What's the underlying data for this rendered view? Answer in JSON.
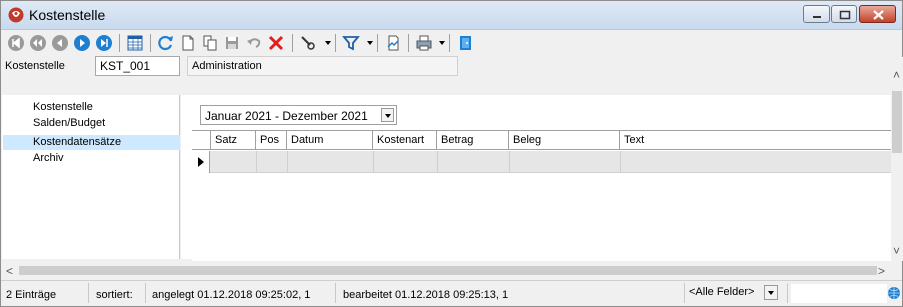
{
  "window": {
    "title": "Kostenstelle"
  },
  "header": {
    "kst_label": "Kostenstelle",
    "kst_value": "KST_001",
    "description": "Administration"
  },
  "nav": {
    "items": [
      {
        "label": "Kostenstelle",
        "selected": false
      },
      {
        "label": "Salden/Budget",
        "selected": false
      },
      {
        "label": "Kostendatensätze",
        "selected": true
      },
      {
        "label": "Archiv",
        "selected": false
      }
    ]
  },
  "content": {
    "period": "Januar 2021 - Dezember 2021",
    "columns": [
      "Satz",
      "Pos",
      "Datum",
      "Kostenart",
      "Betrag",
      "Beleg",
      "Text"
    ]
  },
  "status": {
    "count": "2 Einträge",
    "sorted": "sortiert:",
    "created": "angelegt 01.12.2018 09:25:02,  1",
    "edited": "bearbeitet 01.12.2018 09:25:13,  1",
    "filter": "<Alle Felder>"
  },
  "colors": {
    "selection": "#cde8ff",
    "close_button": "#c2432a",
    "titlebar": "#c9daee"
  },
  "icons": [
    "first-record-icon",
    "previous-page-icon",
    "previous-record-icon",
    "next-record-icon",
    "last-record-icon",
    "table-view-icon",
    "refresh-icon",
    "new-icon",
    "copy-icon",
    "save-icon",
    "undo-icon",
    "delete-icon",
    "search-icon",
    "filter-icon",
    "report-icon",
    "print-icon",
    "exit-icon"
  ]
}
